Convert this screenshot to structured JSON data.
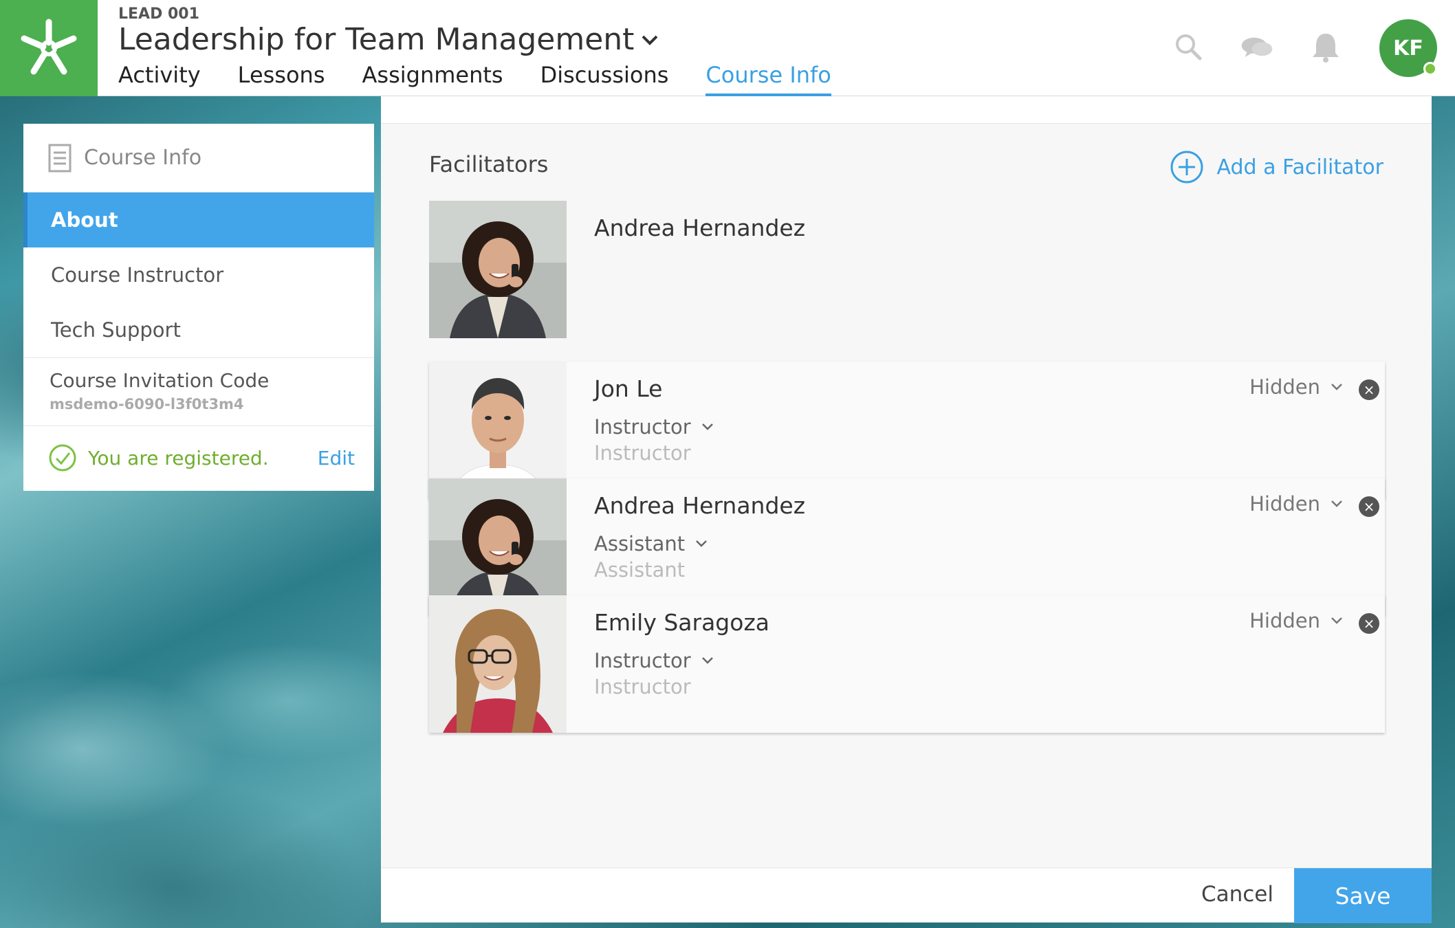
{
  "header": {
    "course_code": "LEAD 001",
    "course_title": "Leadership for Team Management",
    "tabs": [
      {
        "label": "Activity",
        "active": false
      },
      {
        "label": "Lessons",
        "active": false
      },
      {
        "label": "Assignments",
        "active": false
      },
      {
        "label": "Discussions",
        "active": false
      },
      {
        "label": "Course Info",
        "active": true
      }
    ],
    "icons": [
      "search-icon",
      "chat-icon",
      "bell-icon"
    ],
    "avatar_initials": "KF",
    "logo_color": "#4caf50",
    "accent_color": "#3aa0e3"
  },
  "sidebar": {
    "heading": "Course Info",
    "items": [
      {
        "label": "About",
        "active": true
      },
      {
        "label": "Course Instructor",
        "active": false
      },
      {
        "label": "Tech Support",
        "active": false
      }
    ],
    "invitation_label": "Course Invitation Code",
    "invitation_code": "msdemo-6090-l3f0t3m4",
    "registered_text": "You are registered.",
    "edit_label": "Edit"
  },
  "main": {
    "section_title": "Facilitators",
    "add_label": "Add a Facilitator",
    "primary_facilitator": {
      "name": "Andrea Hernandez"
    },
    "facilitators": [
      {
        "name": "Jon Le",
        "role": "Instructor",
        "role_display": "Instructor",
        "visibility": "Hidden"
      },
      {
        "name": "Andrea Hernandez",
        "role": "Assistant",
        "role_display": "Assistant",
        "visibility": "Hidden"
      },
      {
        "name": "Emily Saragoza",
        "role": "Instructor",
        "role_display": "Instructor",
        "visibility": "Hidden"
      }
    ],
    "cancel_label": "Cancel",
    "save_label": "Save"
  }
}
